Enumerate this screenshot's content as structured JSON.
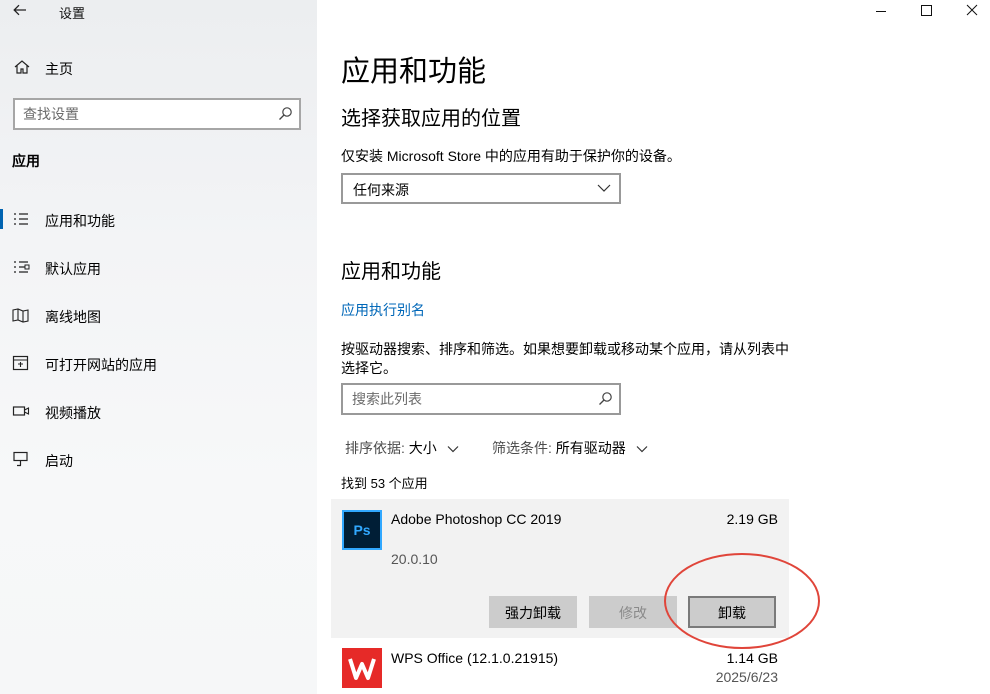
{
  "window": {
    "title": "设置"
  },
  "sidebar": {
    "home_label": "主页",
    "search_placeholder": "查找设置",
    "section_title": "应用",
    "items": [
      {
        "label": "应用和功能",
        "icon": "apps-features-icon",
        "selected": true
      },
      {
        "label": "默认应用",
        "icon": "default-apps-icon"
      },
      {
        "label": "离线地图",
        "icon": "offline-maps-icon"
      },
      {
        "label": "可打开网站的应用",
        "icon": "apps-for-websites-icon"
      },
      {
        "label": "视频播放",
        "icon": "video-playback-icon"
      },
      {
        "label": "启动",
        "icon": "startup-icon"
      }
    ]
  },
  "main": {
    "title": "应用和功能",
    "choose_heading": "选择获取应用的位置",
    "choose_desc": "仅安装 Microsoft Store 中的应用有助于保护你的设备。",
    "source_dropdown": "任何来源",
    "apps_heading": "应用和功能",
    "alias_link": "应用执行别名",
    "list_desc": "按驱动器搜索、排序和筛选。如果想要卸载或移动某个应用，请从列表中选择它。",
    "list_search_placeholder": "搜索此列表",
    "sort_label": "排序依据:",
    "sort_value": "大小",
    "filter_label": "筛选条件:",
    "filter_value": "所有驱动器",
    "count_text": "找到 53 个应用",
    "apps": [
      {
        "name": "Adobe Photoshop CC 2019",
        "size": "2.19 GB",
        "version": "20.0.10",
        "icon_text": "Ps",
        "buttons": {
          "force": "强力卸载",
          "modify": "修改",
          "uninstall": "卸载"
        }
      },
      {
        "name": "WPS Office (12.1.0.21915)",
        "size": "1.14 GB",
        "date": "2025/6/23"
      }
    ]
  },
  "colors": {
    "accent": "#0063b1",
    "link": "#0067b8",
    "annotation": "#e0453a"
  }
}
